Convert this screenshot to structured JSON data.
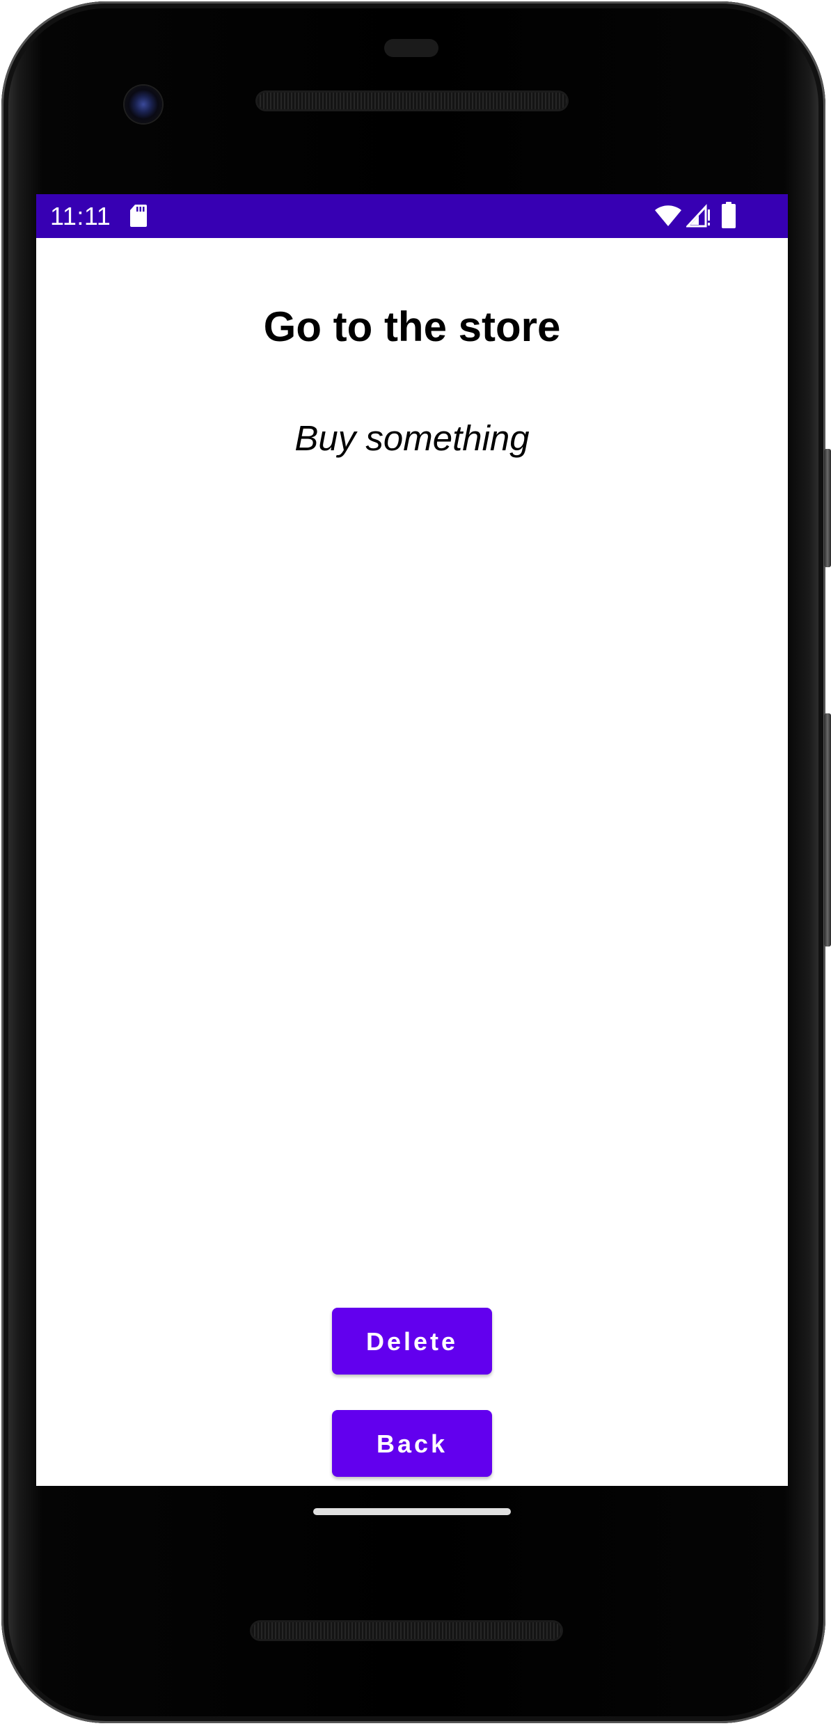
{
  "status_bar": {
    "time": "11:11",
    "background_color": "#3700b3",
    "icons": [
      "sd-card-icon",
      "wifi-icon",
      "cell-signal-icon",
      "battery-icon"
    ]
  },
  "content": {
    "title": "Go to the store",
    "description": "Buy something"
  },
  "actions": {
    "delete_label": "Delete",
    "back_label": "Back",
    "button_color": "#6200ee"
  }
}
